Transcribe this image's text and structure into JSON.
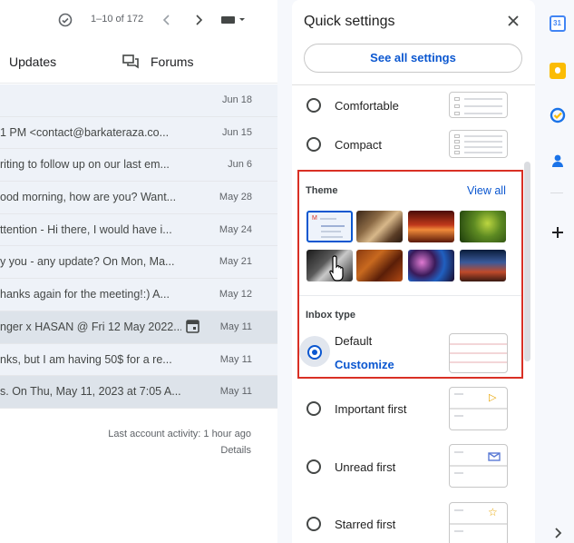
{
  "toolbar": {
    "pager": "1–10 of 172"
  },
  "tabs": {
    "updates": "Updates",
    "forums": "Forums"
  },
  "emails": [
    {
      "snippet": "",
      "date": "Jun 18"
    },
    {
      "snippet": "1 PM <contact@barkateraza.co...",
      "date": "Jun 15"
    },
    {
      "snippet": "riting to follow up on our last em...",
      "date": "Jun 6"
    },
    {
      "snippet": "ood morning, how are you? Want...",
      "date": "May 28"
    },
    {
      "snippet": "ttention - Hi there, I would have i...",
      "date": "May 24"
    },
    {
      "snippet": "y you - any update? On Mon, Ma...",
      "date": "May 21"
    },
    {
      "snippet": "hanks again for the meeting!:) A...",
      "date": "May 12"
    },
    {
      "snippet": "nger x HASAN @ Fri 12 May 2022...",
      "date": "May 11"
    },
    {
      "snippet": "nks, but I am having 50$ for a re...",
      "date": "May 11"
    },
    {
      "snippet": "s. On Thu, May 11, 2023 at 7:05 A...",
      "date": "May 11"
    }
  ],
  "activity": {
    "line1": "Last account activity: 1 hour ago",
    "details": "Details"
  },
  "quick_settings": {
    "title": "Quick settings",
    "see_all": "See all settings",
    "density": {
      "comfortable": "Comfortable",
      "compact": "Compact"
    },
    "theme": {
      "title": "Theme",
      "view_all": "View all"
    },
    "inbox": {
      "title": "Inbox type",
      "default": "Default",
      "customize": "Customize",
      "important": "Important first",
      "unread": "Unread first",
      "starred": "Starred first"
    }
  },
  "icons": [
    "check-circle-icon",
    "chevron-left-icon",
    "chevron-right-icon",
    "keyboard-icon",
    "forum-icon",
    "close-icon",
    "calendar-icon",
    "keep-icon",
    "tasks-icon",
    "contacts-icon",
    "plus-icon",
    "expand-icon"
  ],
  "colors": {
    "accent": "#0b57d0",
    "highlight": "#d93025"
  }
}
